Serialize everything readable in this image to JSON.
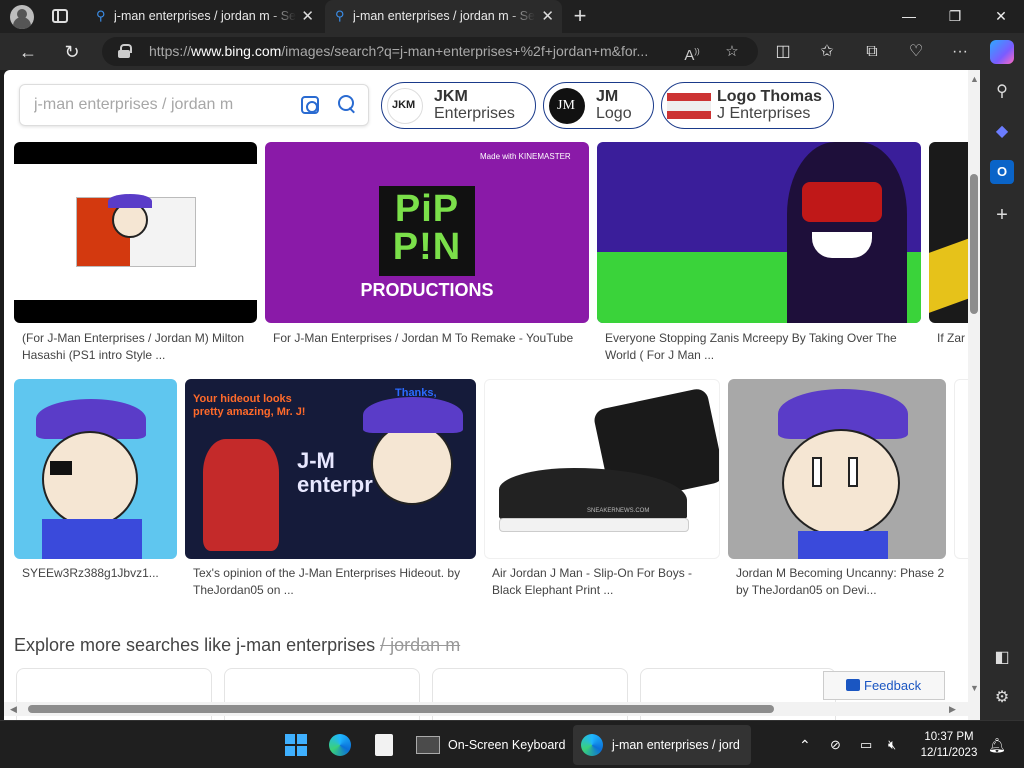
{
  "browser": {
    "tabs": [
      {
        "title": "j-man enterprises / jordan m - Se",
        "active": false
      },
      {
        "title": "j-man enterprises / jordan m - Se",
        "active": true
      }
    ],
    "url_prefix": "https://",
    "url_domain": "www.bing.com",
    "url_rest": "/images/search?q=j-man+enterprises+%2f+jordan+m&for..."
  },
  "search": {
    "query": "j-man enterprises / jordan m"
  },
  "chips": [
    {
      "line1": "JKM",
      "line2": "Enterprises",
      "thumb_text": "JKM"
    },
    {
      "line1": "JM",
      "line2": "Logo",
      "thumb_text": "JM"
    },
    {
      "line1": "Logo Thomas",
      "line2": "J Enterprises",
      "thumb_text": ""
    }
  ],
  "results_row1": [
    {
      "caption": "(For J-Man Enterprises / Jordan M) Milton Hasashi (PS1 intro Style ..."
    },
    {
      "caption": "For J-Man Enterprises / Jordan M To Remake - YouTube",
      "overlay_brand": "Made with KINEMASTER",
      "overlay_title": "PiP P!N",
      "overlay_sub": "PRODUCTIONS"
    },
    {
      "caption": "Everyone Stopping Zanis Mcreepy By Taking Over The World ( For J Man ..."
    },
    {
      "caption": "If Zar Fox ("
    }
  ],
  "results_row2": [
    {
      "caption": "SYEEw3Rz388g1Jbvz1..."
    },
    {
      "caption": "Tex's opinion of the J-Man Enterprises Hideout. by TheJordan05 on ...",
      "overlay_left": "Your hideout looks pretty amazing, Mr. J!",
      "overlay_right": "Thanks, buddy!",
      "overlay_sign": "J-M enterpr"
    },
    {
      "caption": "Air Jordan J Man - Slip-On For Boys - Black Elephant Print ...",
      "overlay_watermark": "SNEAKERNEWS.COM"
    },
    {
      "caption": "Jordan M Becoming Uncanny: Phase 2 by TheJordan05 on Devi..."
    }
  ],
  "explore": {
    "prefix": "Explore more searches like j-man enterprises ",
    "struck": "/ jordan m"
  },
  "feedback_label": "Feedback",
  "taskbar": {
    "apps": [
      {
        "label": "On-Screen Keyboard"
      },
      {
        "label": "j-man enterprises / jord"
      }
    ],
    "time": "10:37 PM",
    "date": "12/11/2023"
  },
  "icons": {
    "back": "back-arrow-icon",
    "refresh": "refresh-icon",
    "lock": "lock-icon",
    "read_aloud": "read-aloud-icon",
    "favorite": "star-icon",
    "split": "split-screen-icon",
    "favorites": "favorites-icon",
    "collections": "collections-icon",
    "performance": "heart-pulse-icon",
    "menu": "more-icon"
  }
}
